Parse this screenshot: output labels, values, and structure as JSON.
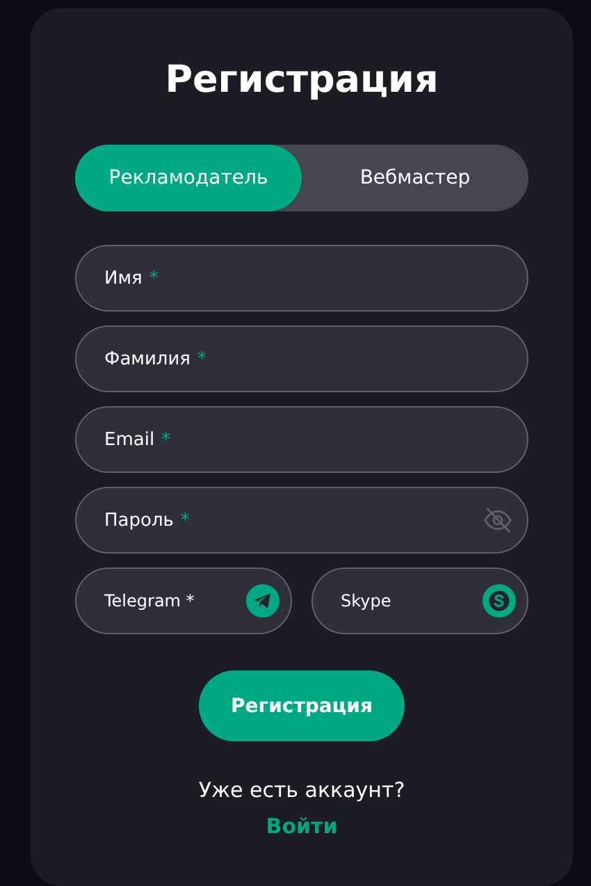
{
  "title": "Регистрация",
  "tabs": [
    {
      "label": "Рекламодатель",
      "selected": true
    },
    {
      "label": "Вебмастер",
      "selected": false
    }
  ],
  "fields": [
    {
      "label": "Имя",
      "required_mark": "*"
    },
    {
      "label": "Фамилия",
      "required_mark": "*"
    },
    {
      "label": "Email",
      "required_mark": "*"
    },
    {
      "label": "Пароль",
      "required_mark": "*",
      "kind": "password"
    }
  ],
  "contact_fields": [
    {
      "label": "Telegram *",
      "kind": "telegram"
    },
    {
      "label": "Skype",
      "kind": "skype"
    }
  ],
  "submit": "Регистрация",
  "login_prompt": "Уже есть аккаунт?",
  "login_link": "Войти"
}
